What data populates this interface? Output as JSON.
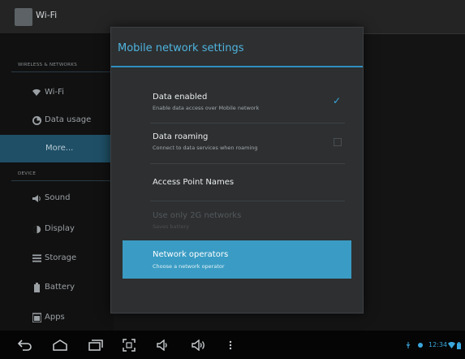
{
  "action_bar": {
    "title": "Wi-Fi"
  },
  "sidebar": {
    "header_wireless": "WIRELESS & NETWORKS",
    "header_device": "DEVICE",
    "items": [
      {
        "label": "Wi-Fi",
        "icon": "wifi-icon"
      },
      {
        "label": "Data usage",
        "icon": "data-usage-icon"
      },
      {
        "label": "More...",
        "icon": "",
        "selected": true
      },
      {
        "label": "Sound",
        "icon": "sound-icon"
      },
      {
        "label": "Display",
        "icon": "display-icon"
      },
      {
        "label": "Storage",
        "icon": "storage-icon"
      },
      {
        "label": "Battery",
        "icon": "battery-icon"
      },
      {
        "label": "Apps",
        "icon": "apps-icon"
      }
    ]
  },
  "dialog": {
    "title": "Mobile network settings",
    "rows": [
      {
        "title": "Data enabled",
        "subtitle": "Enable data access over Mobile network",
        "checked": true
      },
      {
        "title": "Data roaming",
        "subtitle": "Connect to data services when roaming",
        "checked": false
      },
      {
        "title": "Access Point Names",
        "subtitle": ""
      },
      {
        "title": "Use only 2G networks",
        "subtitle": "Saves battery",
        "disabled": true
      },
      {
        "title": "Network operators",
        "subtitle": "Choose a network operator",
        "highlighted": true
      }
    ]
  },
  "nav_bar": {
    "icons": [
      "back-icon",
      "home-icon",
      "recent-apps-icon",
      "screenshot-icon",
      "volume-down-icon",
      "volume-up-icon",
      "menu-icon"
    ],
    "clock": "12:34"
  },
  "colors": {
    "accent": "#3aa7dd",
    "highlight": "#3a9cc4",
    "dialog_bg": "#2d2f31"
  }
}
